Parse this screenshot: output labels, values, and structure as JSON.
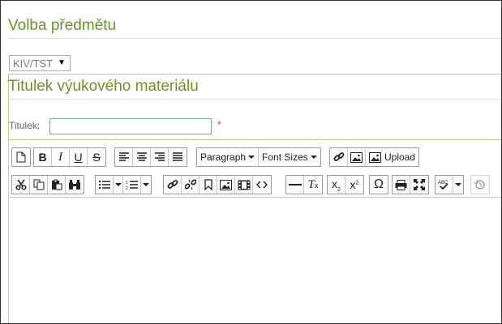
{
  "sections": {
    "subject_title": "Volba předmětu",
    "material_title": "Titulek výukového materiálu"
  },
  "subject_select": {
    "selected": "KIV/TST"
  },
  "title_field": {
    "label": "Titulek:",
    "value": "",
    "required_mark": "*"
  },
  "toolbar": {
    "row1": {
      "format_dropdown": "Paragraph",
      "font_size_dropdown": "Font Sizes",
      "upload_label": "Upload",
      "icons": [
        "new-document-icon",
        "bold-icon",
        "italic-icon",
        "underline-icon",
        "strikethrough-icon",
        "align-left-icon",
        "align-center-icon",
        "align-right-icon",
        "align-justify-icon",
        "link-icon",
        "image-icon",
        "upload-image-icon"
      ]
    },
    "row2": {
      "icons": [
        "cut-icon",
        "copy-icon",
        "paste-icon",
        "find-icon",
        "bullet-list-icon",
        "numbered-list-icon",
        "insert-link-icon",
        "unlink-icon",
        "bookmark-icon",
        "insert-image-icon",
        "insert-media-icon",
        "source-code-icon",
        "horizontal-rule-icon",
        "clear-formatting-icon",
        "subscript-icon",
        "superscript-icon",
        "special-char-icon",
        "print-icon",
        "fullscreen-icon",
        "spellcheck-icon",
        "restore-draft-icon"
      ]
    }
  }
}
